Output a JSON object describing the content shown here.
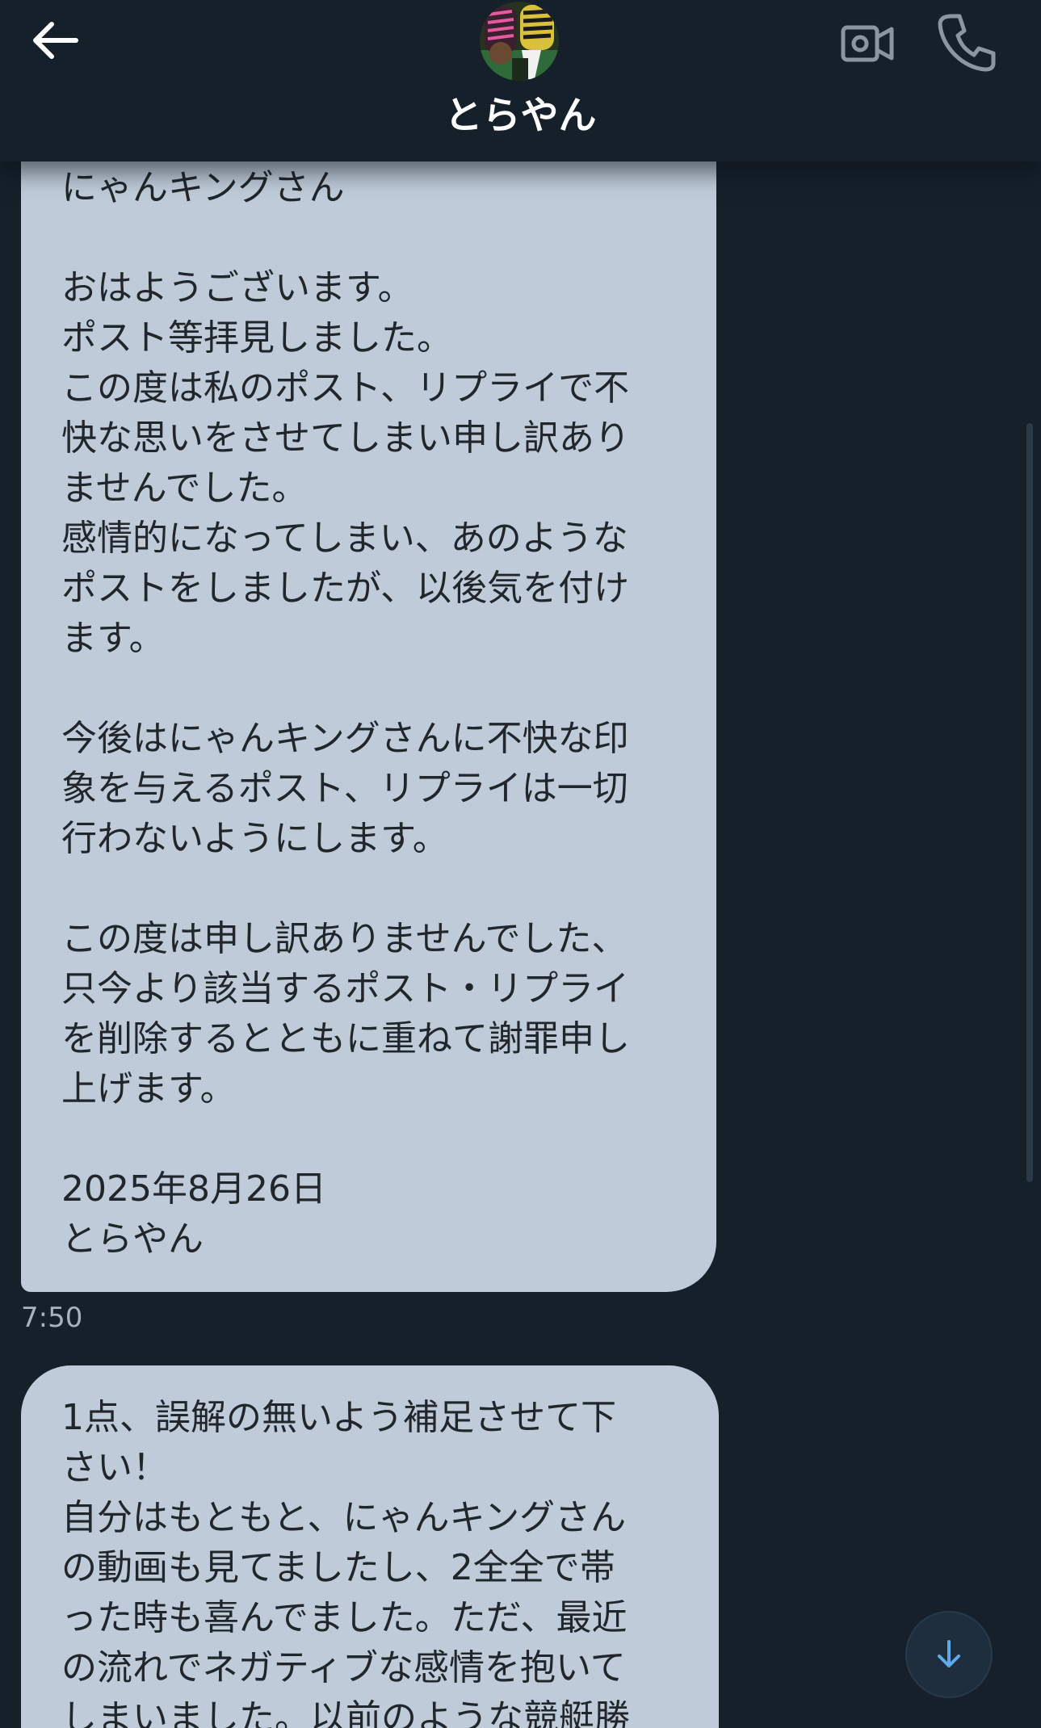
{
  "header": {
    "contact_name": "とらやん",
    "avatar_alt": "とらやん avatar"
  },
  "messages": [
    {
      "lines": [
        "にゃんキングさん",
        "",
        "おはようございます。",
        "ポスト等拝見しました。",
        "この度は私のポスト、リプライで不",
        "快な思いをさせてしまい申し訳あり",
        "ませんでした。",
        "感情的になってしまい、あのような",
        "ポストをしましたが、以後気を付け",
        "ます。",
        "",
        "今後はにゃんキングさんに不快な印",
        "象を与えるポスト、リプライは一切",
        "行わないようにします。",
        "",
        "この度は申し訳ありませんでした、",
        "只今より該当するポスト・リプライ",
        "を削除するとともに重ねて謝罪申し",
        "上げます。",
        "",
        "2025年8月26日",
        "とらやん"
      ],
      "timestamp": "7:50"
    },
    {
      "lines": [
        "1点、誤解の無いよう補足させて下",
        "さい！",
        "自分はもともと、にゃんキングさん",
        "の動画も見てましたし、2全全で帯",
        "った時も喜んでました。ただ、最近",
        "の流れでネガティブな感情を抱いて",
        "しまいました。以前のような競艇勝"
      ]
    }
  ],
  "colors": {
    "background": "#16202b",
    "bubble": "#bfcbd8",
    "bubble_text": "#20262c",
    "icon": "#8b96a2",
    "accent": "#5ea9ea"
  }
}
